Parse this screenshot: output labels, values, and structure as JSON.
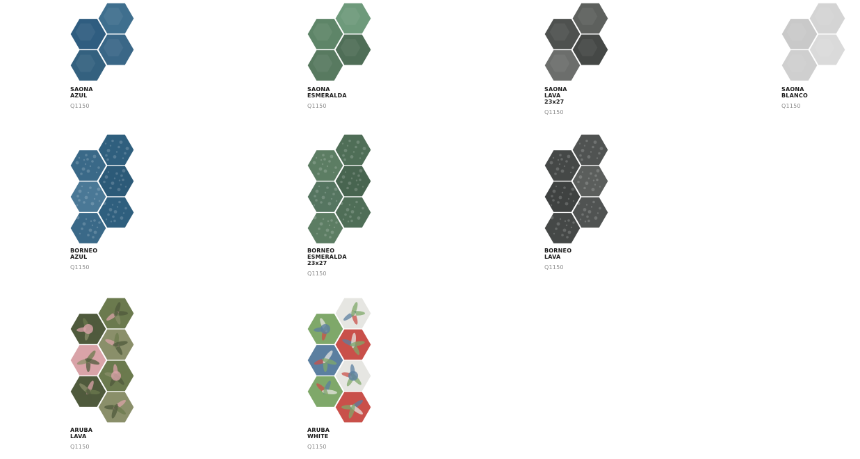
{
  "products": [
    {
      "id": "saona-azul",
      "lines": [
        "SAONA",
        "AZUL"
      ],
      "code": "Q1150",
      "hex_colors": [
        "#3f6f8e",
        "#2f5d80",
        "#3a6787",
        "#34617f"
      ],
      "texture": "plain"
    },
    {
      "id": "saona-esmeralda",
      "lines": [
        "SAONA",
        "ESMERALDA"
      ],
      "code": "Q1150",
      "hex_colors": [
        "#6e9a7b",
        "#5e8568",
        "#4f6e57",
        "#587a60"
      ],
      "texture": "plain"
    },
    {
      "id": "saona-lava",
      "lines": [
        "SAONA",
        "LAVA",
        "23x27"
      ],
      "code": "Q1150",
      "hex_colors": [
        "#5d605d",
        "#4e514f",
        "#454846",
        "#6c6e6c"
      ],
      "texture": "plain"
    },
    {
      "id": "saona-blanco",
      "lines": [
        "SAONA",
        "BLANCO"
      ],
      "code": "Q1150",
      "hex_colors": [
        "#d4d4d4",
        "#c9c9c9",
        "#dadada",
        "#cfcfcf"
      ],
      "texture": "plain"
    },
    {
      "id": "borneo-azul",
      "lines": [
        "BORNEO",
        "AZUL"
      ],
      "code": "Q1150",
      "hex_colors": [
        "#2f5f7e",
        "#3a6988",
        "#2c5a78",
        "#4a7896"
      ],
      "texture": "speckle"
    },
    {
      "id": "borneo-esmeralda",
      "lines": [
        "BORNEO",
        "ESMERALDA",
        "23x27"
      ],
      "code": "Q1150",
      "hex_colors": [
        "#4f6e57",
        "#5c7d63",
        "#486550",
        "#557560"
      ],
      "texture": "speckle"
    },
    {
      "id": "borneo-lava",
      "lines": [
        "BORNEO",
        "LAVA"
      ],
      "code": "Q1150",
      "hex_colors": [
        "#505352",
        "#454847",
        "#5b5e5c",
        "#3f4241"
      ],
      "texture": "speckle"
    },
    {
      "id": "aruba-lava",
      "lines": [
        "ARUBA",
        "LAVA"
      ],
      "code": "Q1150",
      "hex_colors": [
        "#6b7a4e",
        "#4f5a3c",
        "#8a8f6a",
        "#d9a3a8"
      ],
      "texture": "leaf"
    },
    {
      "id": "aruba-white",
      "lines": [
        "ARUBA",
        "WHITE"
      ],
      "code": "Q1150",
      "hex_colors": [
        "#e6e6e2",
        "#7fa86a",
        "#c9504a",
        "#5b7fa0"
      ],
      "texture": "leaf"
    }
  ]
}
